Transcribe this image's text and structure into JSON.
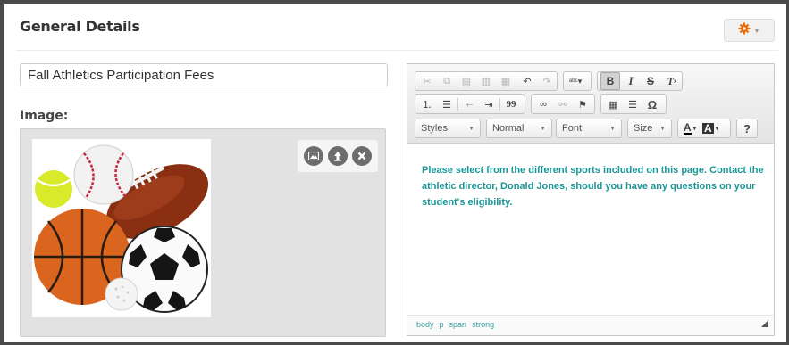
{
  "panel": {
    "title": "General Details"
  },
  "settings_menu": {
    "icon": "gear-icon",
    "color": "#f06a00"
  },
  "form": {
    "title_value": "Fall Athletics Participation Fees",
    "image_label": "Image:"
  },
  "image_actions": [
    "image-icon",
    "upload-icon",
    "remove-icon"
  ],
  "editor": {
    "toolbar_row1": [
      "cut",
      "copy",
      "paste",
      "paste-text",
      "paste-word",
      "undo",
      "redo",
      "spellcheck",
      "bold",
      "italic",
      "strikethrough",
      "remove-format"
    ],
    "toolbar_row2": [
      "numbered-list",
      "bulleted-list",
      "outdent",
      "indent",
      "blockquote",
      "link",
      "unlink",
      "anchor",
      "table",
      "horizontal-rule",
      "special-char"
    ],
    "bold_label": "B",
    "italic_label": "I",
    "strike_label": "S",
    "omega_label": "Ω",
    "quote_label": "99",
    "styles_combo": "Styles",
    "format_combo": "Normal",
    "font_combo": "Font",
    "size_combo": "Size",
    "text_color_label": "A",
    "bg_color_label": "A",
    "help_label": "?",
    "content": "Please select from the different sports included on this page. Contact the athletic director, Donald Jones, should you have any questions on your student's eligibility.",
    "content_color": "#1a9696",
    "path": [
      "body",
      "p",
      "span",
      "strong"
    ]
  }
}
